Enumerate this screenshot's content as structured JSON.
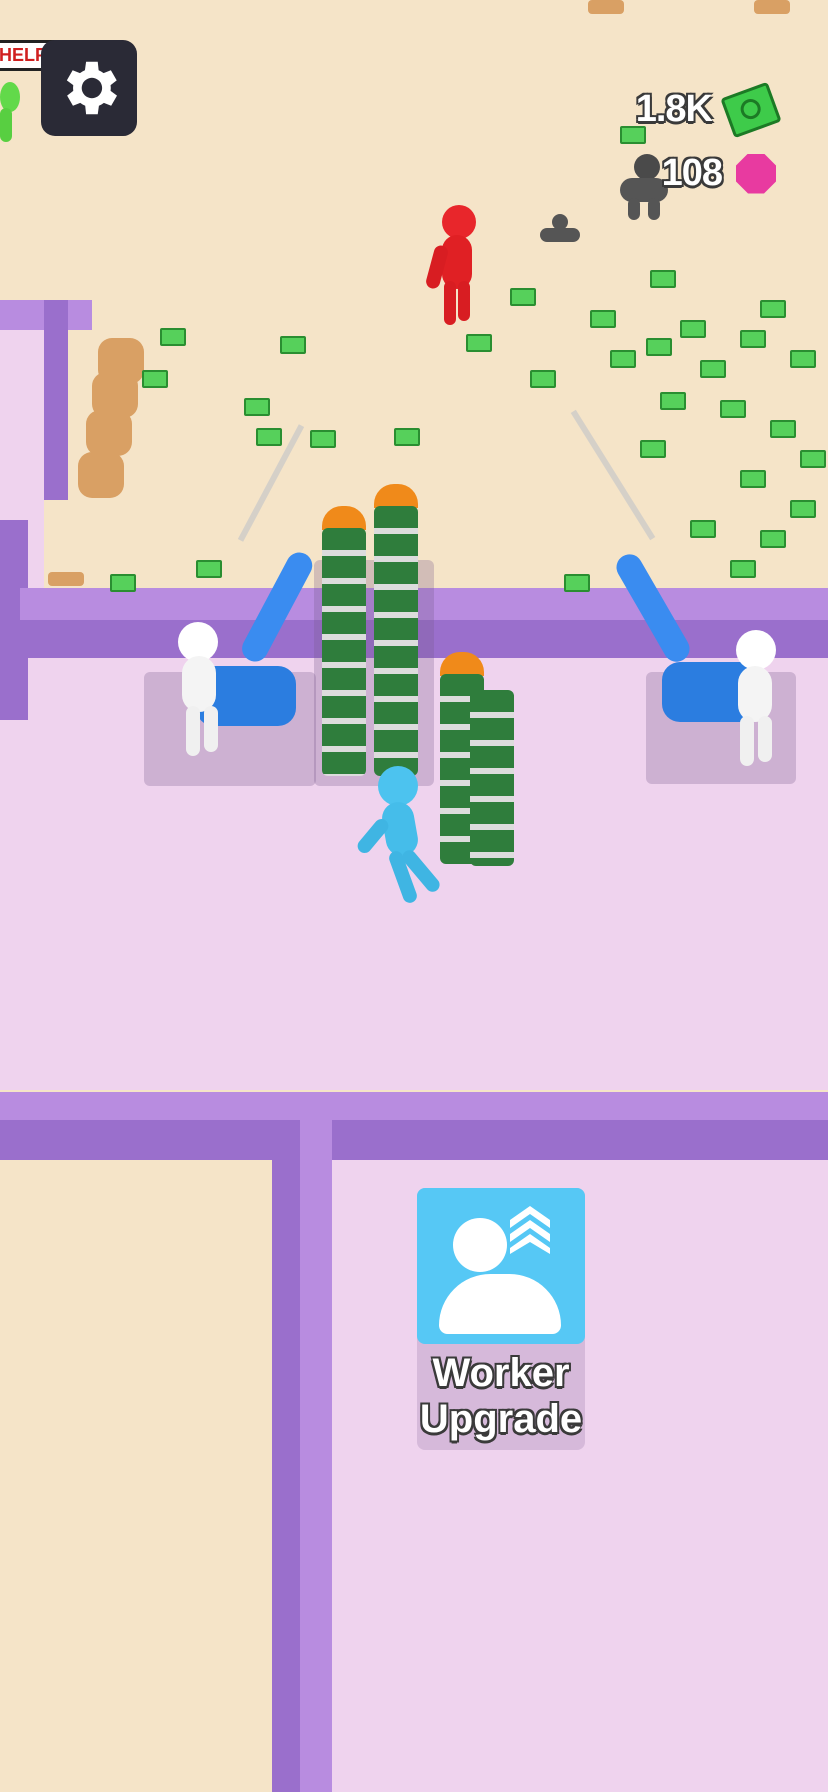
{
  "hud": {
    "settings_icon": "gear-icon",
    "cash_value": "1.8K",
    "cash_icon": "cash-icon",
    "gem_value": "108",
    "gem_icon": "gem-icon"
  },
  "help_bubble": "HELP!",
  "upgrade_station": {
    "label_line1": "Worker",
    "label_line2": "Upgrade",
    "icon": "worker-upgrade-icon"
  },
  "colors": {
    "sand": "#f5e4c8",
    "floor": "#efd3ee",
    "wall": "#b88ce0",
    "cash_green": "#3ecb4a",
    "gem_pink": "#e83aa0",
    "player_blue": "#4cc3ef",
    "enemy_red": "#e8262b"
  }
}
